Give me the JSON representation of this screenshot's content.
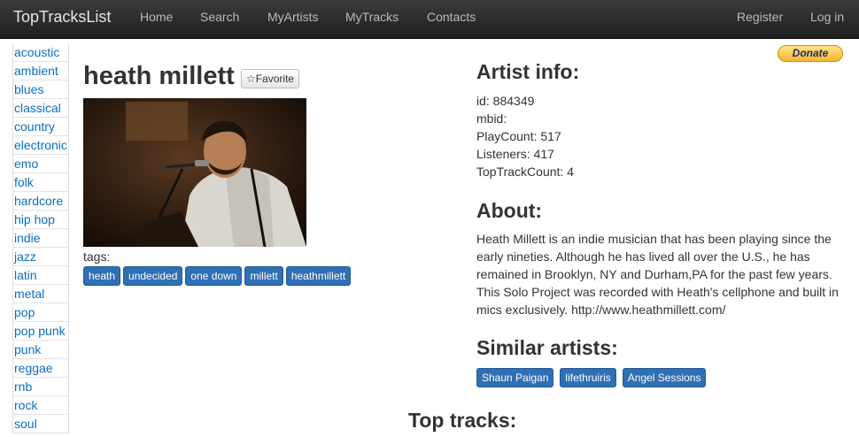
{
  "navbar": {
    "brand": "TopTracksList",
    "links": [
      "Home",
      "Search",
      "MyArtists",
      "MyTracks",
      "Contacts"
    ],
    "register": "Register",
    "login": "Log in"
  },
  "sidebar": {
    "tags": [
      "acoustic",
      "ambient",
      "blues",
      "classical",
      "country",
      "electronic",
      "emo",
      "folk",
      "hardcore",
      "hip hop",
      "indie",
      "jazz",
      "latin",
      "metal",
      "pop",
      "pop punk",
      "punk",
      "reggae",
      "rnb",
      "rock",
      "soul"
    ]
  },
  "artist": {
    "name": "heath millett",
    "favorite_label": "☆Favorite",
    "tags_label": "tags:",
    "tags": [
      "heath",
      "undecided",
      "one down",
      "millett",
      "heathmillett"
    ]
  },
  "info": {
    "heading": "Artist info:",
    "id": "id: 884349",
    "mbid": "mbid:",
    "playcount": "PlayCount: 517",
    "listeners": "Listeners: 417",
    "toptrackcount": "TopTrackCount: 4"
  },
  "about": {
    "heading": "About:",
    "text": "Heath Millett is an indie musician that has been playing since the early nineties. Although he has lived all over the U.S., he has remained in Brooklyn, NY and Durham,PA for the past few years. This Solo Project was recorded with Heath's cellphone and built in mics exclusively. http://www.heathmillett.com/"
  },
  "similar": {
    "heading": "Similar artists:",
    "artists": [
      "Shaun Paigan",
      "lifethruiris",
      "Angel Sessions"
    ]
  },
  "top_tracks": {
    "heading": "Top tracks:"
  },
  "donate": {
    "label": "Donate"
  },
  "colors": {
    "navbar": "#2b2b2b",
    "link": "#0a6fc2",
    "label": "#2f6fb4"
  }
}
